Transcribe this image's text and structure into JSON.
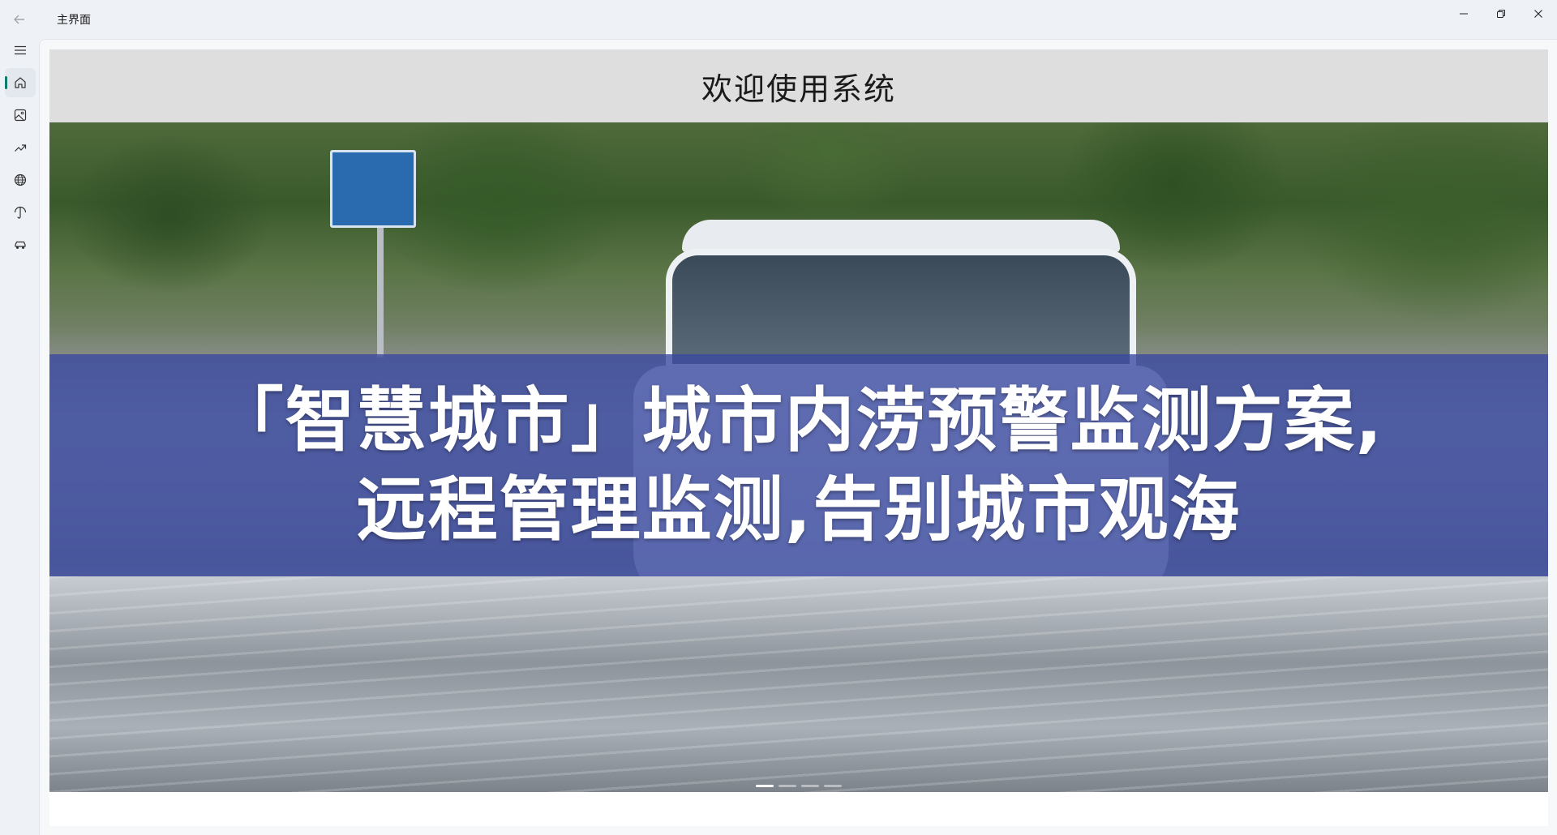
{
  "window": {
    "title": "主界面",
    "controls": {
      "minimize_icon": "minimize-icon",
      "restore_icon": "restore-icon",
      "close_icon": "close-icon"
    }
  },
  "sidebar": {
    "menu_icon": "hamburger-menu-icon",
    "items": [
      {
        "icon": "home-icon",
        "selected": true
      },
      {
        "icon": "image-icon",
        "selected": false
      },
      {
        "icon": "trend-up-icon",
        "selected": false
      },
      {
        "icon": "globe-icon",
        "selected": false
      },
      {
        "icon": "umbrella-icon",
        "selected": false
      },
      {
        "icon": "car-icon",
        "selected": false
      }
    ],
    "accent_color": "#0f7b6c"
  },
  "main": {
    "title": "欢迎使用系统",
    "banner": {
      "line1": "「智慧城市」城市内涝预警监测方案,",
      "line2": "远程管理监测,告别城市观海",
      "band_color": "#3848a0",
      "slides": 4,
      "active_slide": 1
    }
  }
}
